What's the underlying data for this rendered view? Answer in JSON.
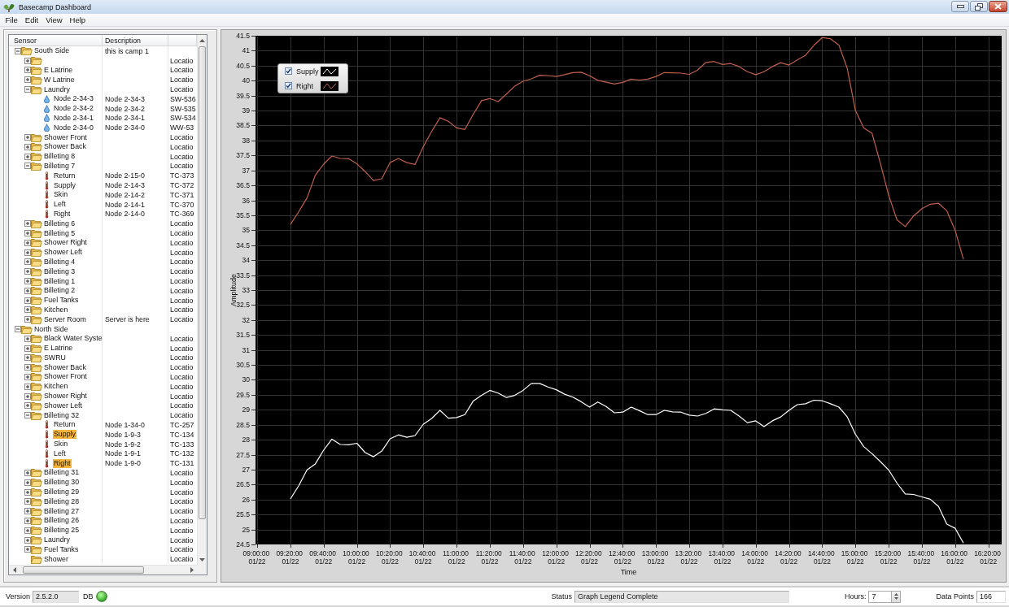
{
  "window": {
    "title": "Basecamp Dashboard"
  },
  "menu": [
    "File",
    "Edit",
    "View",
    "Help"
  ],
  "tree": {
    "columns": [
      "Sensor",
      "Description"
    ],
    "rows": [
      {
        "label": "South Side",
        "kind": "folder",
        "expanded": true,
        "selected": false,
        "description": "this is camp 1",
        "children": [
          {
            "kind": "folder",
            "expanded": false,
            "selected": false,
            "column_3": "Locatio"
          },
          {
            "label": "E Latrine",
            "kind": "folder",
            "expanded": false,
            "selected": false,
            "column_3": "Locatio"
          },
          {
            "label": "W Latrine",
            "kind": "folder",
            "expanded": false,
            "selected": false,
            "column_3": "Locatio"
          },
          {
            "label": "Laundry",
            "kind": "folder",
            "expanded": true,
            "selected": false,
            "column_3": "Locatio",
            "children": [
              {
                "label": "Node 2-34-3",
                "kind": "water-sensor",
                "selected": false,
                "description": "Node 2-34-3",
                "column_3": "SW-536"
              },
              {
                "label": "Node 2-34-2",
                "kind": "water-sensor",
                "selected": false,
                "description": "Node 2-34-2",
                "column_3": "SW-535"
              },
              {
                "label": "Node 2-34-1",
                "kind": "water-sensor",
                "selected": false,
                "description": "Node 2-34-1",
                "column_3": "SW-534"
              },
              {
                "label": "Node 2-34-0",
                "kind": "water-sensor",
                "selected": false,
                "description": "Node 2-34-0",
                "column_3": "WW-53"
              }
            ]
          },
          {
            "label": "Shower Front",
            "kind": "folder",
            "expanded": false,
            "selected": false,
            "column_3": "Locatio"
          },
          {
            "label": "Shower Back",
            "kind": "folder",
            "expanded": false,
            "selected": false,
            "column_3": "Locatio"
          },
          {
            "label": "Billeting 8",
            "kind": "folder",
            "expanded": false,
            "selected": false,
            "column_3": "Locatio"
          },
          {
            "label": "Billeting 7",
            "kind": "folder",
            "expanded": true,
            "selected": false,
            "column_3": "Locatio",
            "children": [
              {
                "label": "Return",
                "kind": "temperature-sensor",
                "selected": false,
                "description": "Node 2-15-0",
                "column_3": "TC-373"
              },
              {
                "label": "Supply",
                "kind": "temperature-sensor",
                "selected": false,
                "description": "Node 2-14-3",
                "column_3": "TC-372"
              },
              {
                "label": "Skin",
                "kind": "temperature-sensor",
                "selected": false,
                "description": "Node 2-14-2",
                "column_3": "TC-371"
              },
              {
                "label": "Left",
                "kind": "temperature-sensor",
                "selected": false,
                "description": "Node 2-14-1",
                "column_3": "TC-370"
              },
              {
                "label": "Right",
                "kind": "temperature-sensor",
                "selected": false,
                "description": "Node 2-14-0",
                "column_3": "TC-369"
              }
            ]
          },
          {
            "label": "Billeting 6",
            "kind": "folder",
            "expanded": false,
            "selected": false,
            "column_3": "Locatio"
          },
          {
            "label": "Billeting 5",
            "kind": "folder",
            "expanded": false,
            "selected": false,
            "column_3": "Locatio"
          },
          {
            "label": "Shower Right",
            "kind": "folder",
            "expanded": false,
            "selected": false,
            "column_3": "Locatio"
          },
          {
            "label": "Shower Left",
            "kind": "folder",
            "expanded": false,
            "selected": false,
            "column_3": "Locatio"
          },
          {
            "label": "Billeting 4",
            "kind": "folder",
            "expanded": false,
            "selected": false,
            "column_3": "Locatio"
          },
          {
            "label": "Billeting 3",
            "kind": "folder",
            "expanded": false,
            "selected": false,
            "column_3": "Locatio"
          },
          {
            "label": "Billeting 1",
            "kind": "folder",
            "expanded": false,
            "selected": false,
            "column_3": "Locatio"
          },
          {
            "label": "Billeting 2",
            "kind": "folder",
            "expanded": false,
            "selected": false,
            "column_3": "Locatio"
          },
          {
            "label": "Fuel Tanks",
            "kind": "folder",
            "expanded": false,
            "selected": false,
            "column_3": "Locatio"
          },
          {
            "label": "Kitchen",
            "kind": "folder",
            "expanded": false,
            "selected": false,
            "column_3": "Locatio"
          },
          {
            "label": "Server Room",
            "kind": "folder",
            "expanded": false,
            "selected": false,
            "description": "Server is here",
            "column_3": "Locatio"
          }
        ]
      },
      {
        "label": "North Side",
        "kind": "folder",
        "expanded": true,
        "selected": false,
        "children": [
          {
            "label": "Black Water Syste",
            "kind": "folder",
            "expanded": false,
            "selected": false,
            "column_3": "Locatio"
          },
          {
            "label": "E Latrine",
            "kind": "folder",
            "expanded": false,
            "selected": false,
            "column_3": "Locatio"
          },
          {
            "label": "SWRU",
            "kind": "folder",
            "expanded": false,
            "selected": false,
            "column_3": "Locatio"
          },
          {
            "label": "Shower Back",
            "kind": "folder",
            "expanded": false,
            "selected": false,
            "column_3": "Locatio"
          },
          {
            "label": "Shower Front",
            "kind": "folder",
            "expanded": false,
            "selected": false,
            "column_3": "Locatio"
          },
          {
            "label": "Kitchen",
            "kind": "folder",
            "expanded": false,
            "selected": false,
            "column_3": "Locatio"
          },
          {
            "label": "Shower Right",
            "kind": "folder",
            "expanded": false,
            "selected": false,
            "column_3": "Locatio"
          },
          {
            "label": "Shower Left",
            "kind": "folder",
            "expanded": false,
            "selected": false,
            "column_3": "Locatio"
          },
          {
            "label": "Billeting 32",
            "kind": "folder",
            "expanded": true,
            "selected": false,
            "column_3": "Locatio",
            "children": [
              {
                "label": "Return",
                "kind": "temperature-sensor",
                "selected": false,
                "description": "Node 1-34-0",
                "column_3": "TC-257"
              },
              {
                "label": "Supply",
                "kind": "temperature-sensor",
                "selected": true,
                "description": "Node 1-9-3",
                "column_3": "TC-134"
              },
              {
                "label": "Skin",
                "kind": "temperature-sensor",
                "selected": false,
                "description": "Node 1-9-2",
                "column_3": "TC-133"
              },
              {
                "label": "Left",
                "kind": "temperature-sensor",
                "selected": false,
                "description": "Node 1-9-1",
                "column_3": "TC-132"
              },
              {
                "label": "Right",
                "kind": "temperature-sensor",
                "selected": true,
                "description": "Node 1-9-0",
                "column_3": "TC-131"
              }
            ]
          },
          {
            "label": "Billeting 31",
            "kind": "folder",
            "expanded": false,
            "selected": false,
            "column_3": "Locatio"
          },
          {
            "label": "Billeting 30",
            "kind": "folder",
            "expanded": false,
            "selected": false,
            "column_3": "Locatio"
          },
          {
            "label": "Billeting 29",
            "kind": "folder",
            "expanded": false,
            "selected": false,
            "column_3": "Locatio"
          },
          {
            "label": "Billeting 28",
            "kind": "folder",
            "expanded": false,
            "selected": false,
            "column_3": "Locatio"
          },
          {
            "label": "Billeting 27",
            "kind": "folder",
            "expanded": false,
            "selected": false,
            "column_3": "Locatio"
          },
          {
            "label": "Billeting 26",
            "kind": "folder",
            "expanded": false,
            "selected": false,
            "column_3": "Locatio"
          },
          {
            "label": "Billeting 25",
            "kind": "folder",
            "expanded": false,
            "selected": false,
            "column_3": "Locatio"
          },
          {
            "label": "Laundry",
            "kind": "folder",
            "expanded": false,
            "selected": false,
            "column_3": "Locatio"
          },
          {
            "label": "Fuel Tanks",
            "kind": "folder",
            "expanded": false,
            "selected": false,
            "column_3": "Locatio"
          },
          {
            "label": "Shower",
            "kind": "folder",
            "selected": false,
            "column_3": "Locatio"
          }
        ]
      }
    ]
  },
  "graph": {
    "legend": [
      {
        "checked": true
      },
      {
        "checked": true
      }
    ],
    "chart_data": {
      "type": "line",
      "xlabel": "Time",
      "ylabel": "Amplitude",
      "grid": true,
      "categories": [
        "09:00:00 01/22",
        null,
        null,
        null,
        "09:20:00 01/22",
        null,
        null,
        null,
        "09:40:00 01/22",
        null,
        null,
        null,
        "10:00:00 01/22",
        null,
        null,
        null,
        "10:20:00 01/22",
        null,
        null,
        null,
        "10:40:00 01/22",
        null,
        null,
        null,
        "11:00:00 01/22",
        null,
        null,
        null,
        "11:20:00 01/22",
        null,
        null,
        null,
        "11:40:00 01/22",
        null,
        null,
        null,
        "12:00:00 01/22",
        null,
        null,
        null,
        "12:20:00 01/22",
        null,
        null,
        null,
        "12:40:00 01/22",
        null,
        null,
        null,
        "13:00:00 01/22",
        null,
        null,
        null,
        "13:20:00 01/22",
        null,
        null,
        null,
        "13:40:00 01/22",
        null,
        null,
        null,
        "14:00:00 01/22",
        null,
        null,
        null,
        "14:20:00 01/22",
        null,
        null,
        null,
        "14:40:00 01/22",
        null,
        null,
        null,
        "15:00:00 01/22",
        null,
        null,
        null,
        "15:20:00 01/22",
        null,
        null,
        null,
        "15:40:00 01/22",
        null,
        null,
        null,
        "16:00:00 01/22",
        null,
        null,
        null,
        "16:20:00 01/22",
        null
      ],
      "series": [
        {
          "name": "Supply",
          "color": "#ffffff",
          "values": [
            null,
            null,
            null,
            null,
            26.02,
            26.46,
            26.99,
            27.19,
            27.65,
            28.02,
            27.84,
            27.83,
            27.88,
            27.57,
            27.43,
            27.62,
            28.03,
            28.16,
            28.08,
            28.14,
            28.52,
            28.71,
            28.98,
            28.72,
            28.74,
            28.84,
            29.29,
            29.48,
            29.65,
            29.56,
            29.41,
            29.48,
            29.65,
            29.88,
            29.88,
            29.76,
            29.67,
            29.52,
            29.42,
            29.27,
            29.09,
            29.26,
            29.11,
            28.9,
            28.92,
            29.09,
            28.97,
            28.84,
            28.84,
            28.98,
            28.93,
            28.92,
            28.82,
            28.79,
            28.88,
            29.03,
            29.0,
            28.98,
            28.79,
            28.57,
            28.63,
            28.44,
            28.63,
            28.76,
            28.98,
            29.17,
            29.2,
            29.32,
            29.3,
            29.2,
            29.09,
            28.77,
            28.18,
            27.77,
            27.53,
            27.27,
            26.99,
            26.55,
            26.19,
            26.17,
            26.09,
            26.01,
            25.77,
            25.18,
            25.04,
            24.55,
            null,
            null,
            null,
            null
          ]
        },
        {
          "name": "Right",
          "color": "#c0604e",
          "values": [
            null,
            null,
            null,
            null,
            35.19,
            35.62,
            36.08,
            36.84,
            37.21,
            37.48,
            37.4,
            37.39,
            37.22,
            36.96,
            36.66,
            36.72,
            37.26,
            37.4,
            37.26,
            37.2,
            37.8,
            38.3,
            38.76,
            38.64,
            38.42,
            38.37,
            38.87,
            39.33,
            39.4,
            39.3,
            39.55,
            39.82,
            39.98,
            40.06,
            40.18,
            40.17,
            40.14,
            40.2,
            40.27,
            40.28,
            40.16,
            40.01,
            39.95,
            39.89,
            39.94,
            40.05,
            40.02,
            40.05,
            40.14,
            40.27,
            40.26,
            40.25,
            40.21,
            40.35,
            40.61,
            40.64,
            40.54,
            40.57,
            40.47,
            40.3,
            40.2,
            40.3,
            40.47,
            40.6,
            40.52,
            40.69,
            40.85,
            41.18,
            41.44,
            41.4,
            41.19,
            40.42,
            39.0,
            38.42,
            38.24,
            37.24,
            36.17,
            35.35,
            35.12,
            35.48,
            35.72,
            35.87,
            35.9,
            35.65,
            35.0,
            34.03,
            null,
            null,
            null,
            null
          ]
        }
      ],
      "ylim": [
        24.5,
        41.5
      ],
      "yticks": [
        24.5,
        25,
        25.5,
        26,
        26.5,
        27,
        27.5,
        28,
        28.5,
        29,
        29.5,
        30,
        30.5,
        31,
        31.5,
        32,
        32.5,
        33,
        33.5,
        34,
        34.5,
        35,
        35.5,
        36,
        36.5,
        37,
        37.5,
        38,
        38.5,
        39,
        39.5,
        40,
        40.5,
        41,
        41.5
      ]
    }
  },
  "status_bar": {
    "version_label": "Version",
    "version": "2.5.2.0",
    "db_label": "DB",
    "db_connected": true,
    "status_label": "Status",
    "status": "Graph Legend Complete",
    "hours_label": "Hours:",
    "hours": "7",
    "data_points_label": "Data Points",
    "data_points": "166"
  }
}
